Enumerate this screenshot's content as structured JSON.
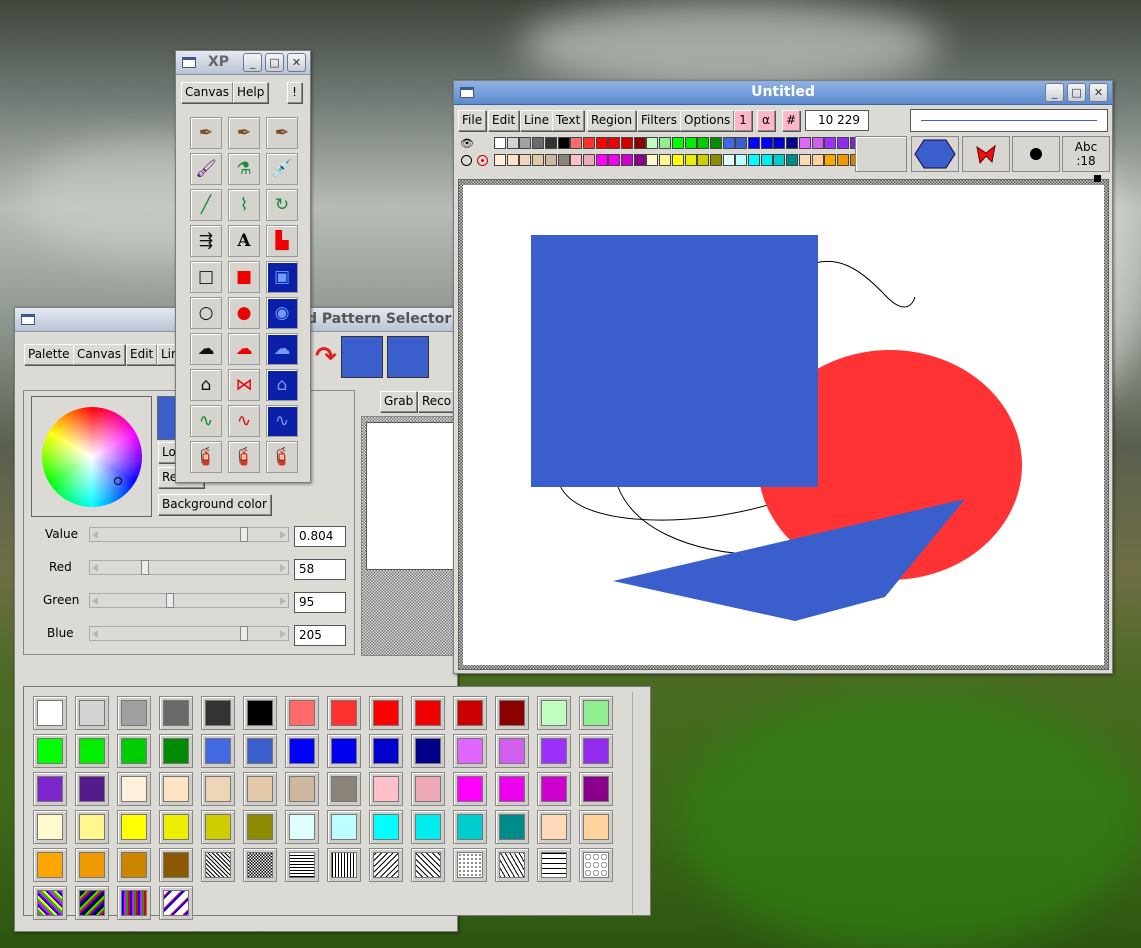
{
  "palette_window": {
    "title": "d Pattern Selector",
    "menu": [
      "Palette",
      "Canvas",
      "Edit",
      "Lin"
    ],
    "buttons": {
      "load": "Lo",
      "reset": "Re",
      "background": "Background color",
      "grab": "Grab",
      "record": "Reco"
    },
    "value_label": "Value",
    "value": "0.804",
    "red_label": "Red",
    "red": "58",
    "green_label": "Green",
    "green": "95",
    "blue_label": "Blue",
    "blue": "205",
    "value_frac": 0.804,
    "red_frac": 0.227,
    "green_frac": 0.373,
    "blue_frac": 0.804,
    "current_color": "#3a5fcd",
    "swatches": [
      "#ffffff",
      "#d3d3d3",
      "#a0a0a0",
      "#6a6a6a",
      "#333333",
      "#000000",
      "#ff6a6a",
      "#ff3030",
      "#ff0000",
      "#ee0000",
      "#cd0000",
      "#8b0000",
      "#c1ffc1",
      "#90ee90",
      "#00ff00",
      "#00ee00",
      "#00cd00",
      "#008b00",
      "#4169e1",
      "#3a5fcd",
      "#0000ff",
      "#0000ee",
      "#0000cd",
      "#00008b",
      "#e066ff",
      "#d15fee",
      "#9b30ff",
      "#912cee",
      "#7d26cd",
      "#551a8b",
      "#ffefdb",
      "#ffe4c4",
      "#eed5b7",
      "#e3c9a8",
      "#cdb79e",
      "#8b8378",
      "#ffc0cb",
      "#eea9b8",
      "#ff00ff",
      "#ee00ee",
      "#cd00cd",
      "#8b008b",
      "#fffacd",
      "#fff68f",
      "#ffff00",
      "#eeee00",
      "#cdcd00",
      "#8b8b00",
      "#e0ffff",
      "#bbffff",
      "#00ffff",
      "#00eeee",
      "#00cdcd",
      "#008b8b",
      "#ffdab9",
      "#ffd39b",
      "#ffa500",
      "#ee9a00",
      "#cd8500",
      "#8b5a00",
      "pat1",
      "pat2",
      "pat3",
      "pat4",
      "pat5",
      "pat6",
      "pat7",
      "pat8",
      "pat9",
      "pat10",
      "multi1",
      "multi2",
      "multi3",
      "multi4"
    ]
  },
  "tools_window": {
    "title": "XP",
    "menu": [
      "Canvas",
      "Help"
    ],
    "alert_button": "!",
    "tools": [
      "pen-brown-icon",
      "pen-brown2-icon",
      "pen-brown3-icon",
      "brush-icon",
      "flask-icon",
      "dropper-icon",
      "line-icon",
      "polyline-icon",
      "arc-icon",
      "arrows-icon",
      "text-tool-icon",
      "fill-icon",
      "rect-outline-icon",
      "rect-filled-icon",
      "rect-dotted-icon",
      "circle-outline-icon",
      "circle-filled-icon",
      "circle-dotted-icon",
      "freeform-outline-icon",
      "freeform-filled-icon",
      "freeform-dotted-icon",
      "polygon-outline-icon",
      "polygon-filled-icon",
      "polygon-dotted-icon",
      "curve-outline-icon",
      "curve-filled-icon",
      "curve-dotted-icon",
      "spray-red-icon",
      "spray-blue-icon",
      "spray-multi-icon"
    ]
  },
  "canvas_window": {
    "title": "Untitled",
    "menu": [
      "File",
      "Edit",
      "Line",
      "Text",
      "Region",
      "Filters",
      "Options"
    ],
    "pink_buttons": [
      "1",
      "α",
      "#"
    ],
    "coords": "10 229",
    "text_sample": "Abc\n:18",
    "top_colors": [
      "#ffffff",
      "#d3d3d3",
      "#a0a0a0",
      "#6a6a6a",
      "#333333",
      "#000000",
      "#ff6a6a",
      "#ff3030",
      "#ff0000",
      "#ee0000",
      "#cd0000",
      "#8b0000",
      "#c1ffc1",
      "#90ee90",
      "#00ff00",
      "#00ee00",
      "#00cd00",
      "#008b00",
      "#4169e1",
      "#3a5fcd",
      "#0000ff",
      "#0000ee",
      "#0000cd",
      "#00008b",
      "#e066ff",
      "#d15fee",
      "#9b30ff",
      "#912cee",
      "#7d26cd",
      "#551a8b"
    ],
    "bottom_colors": [
      "#ffefdb",
      "#ffe4c4",
      "#eed5b7",
      "#e3c9a8",
      "#cdb79e",
      "#8b8378",
      "#ffc0cb",
      "#eea9b8",
      "#ff00ff",
      "#ee00ee",
      "#cd00cd",
      "#8b008b",
      "#fffacd",
      "#fff68f",
      "#ffff00",
      "#eeee00",
      "#cdcd00",
      "#8b8b00",
      "#e0ffff",
      "#bbffff",
      "#00ffff",
      "#00eeee",
      "#00cdcd",
      "#008b8b",
      "#ffdab9",
      "#ffd39b",
      "#ffa500",
      "#ee9a00",
      "#cd8500",
      "#8b5a00"
    ],
    "shape_blue": "#3a5fcd",
    "shape_red": "#ff3333"
  }
}
